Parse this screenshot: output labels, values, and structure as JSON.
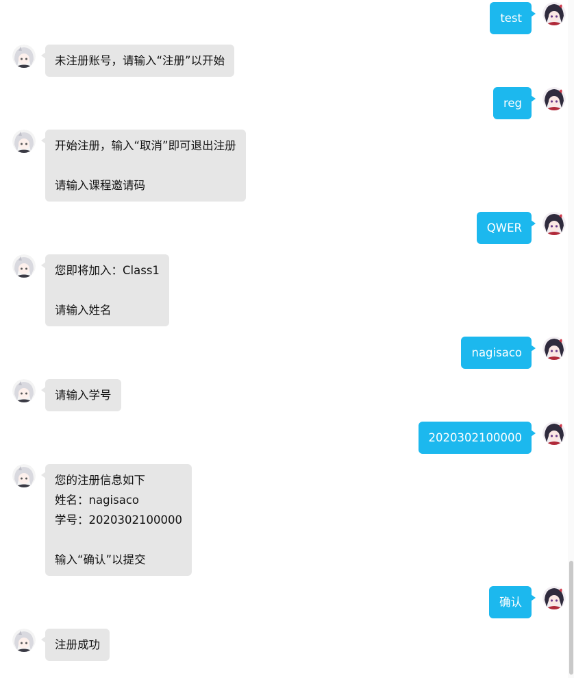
{
  "colors": {
    "user_bubble": "#1cb8ee",
    "bot_bubble": "#e6e6e6",
    "background": "#ffffff"
  },
  "avatars": {
    "user": "anime-girl-dark-hair-avatar",
    "bot": "anime-girl-white-hair-avatar"
  },
  "messages": [
    {
      "sender": "user",
      "text": "test"
    },
    {
      "sender": "bot",
      "text": "未注册账号，请输入“注册”以开始"
    },
    {
      "sender": "user",
      "text": "reg"
    },
    {
      "sender": "bot",
      "text": "开始注册，输入“取消”即可退出注册\n\n请输入课程邀请码"
    },
    {
      "sender": "user",
      "text": "QWER"
    },
    {
      "sender": "bot",
      "text": "您即将加入：Class1\n\n请输入姓名"
    },
    {
      "sender": "user",
      "text": "nagisaco"
    },
    {
      "sender": "bot",
      "text": "请输入学号"
    },
    {
      "sender": "user",
      "text": "2020302100000"
    },
    {
      "sender": "bot",
      "text": "您的注册信息如下\n姓名：nagisaco\n学号：2020302100000\n\n输入“确认”以提交"
    },
    {
      "sender": "user",
      "text": "确认"
    },
    {
      "sender": "bot",
      "text": "注册成功"
    }
  ]
}
